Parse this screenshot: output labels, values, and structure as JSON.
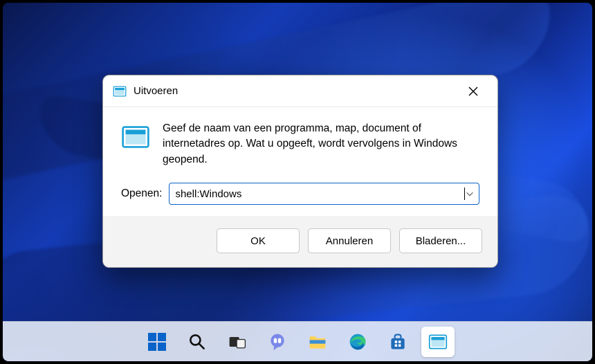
{
  "dialog": {
    "title": "Uitvoeren",
    "description": "Geef de naam van een programma, map, document of internetadres op. Wat u opgeeft, wordt vervolgens in Windows geopend.",
    "open_label": "Openen:",
    "open_value": "shell:Windows",
    "buttons": {
      "ok": "OK",
      "cancel": "Annuleren",
      "browse": "Bladeren..."
    }
  },
  "taskbar": {
    "items": [
      "start",
      "search",
      "task-view",
      "chat",
      "explorer",
      "edge",
      "store",
      "run"
    ]
  }
}
